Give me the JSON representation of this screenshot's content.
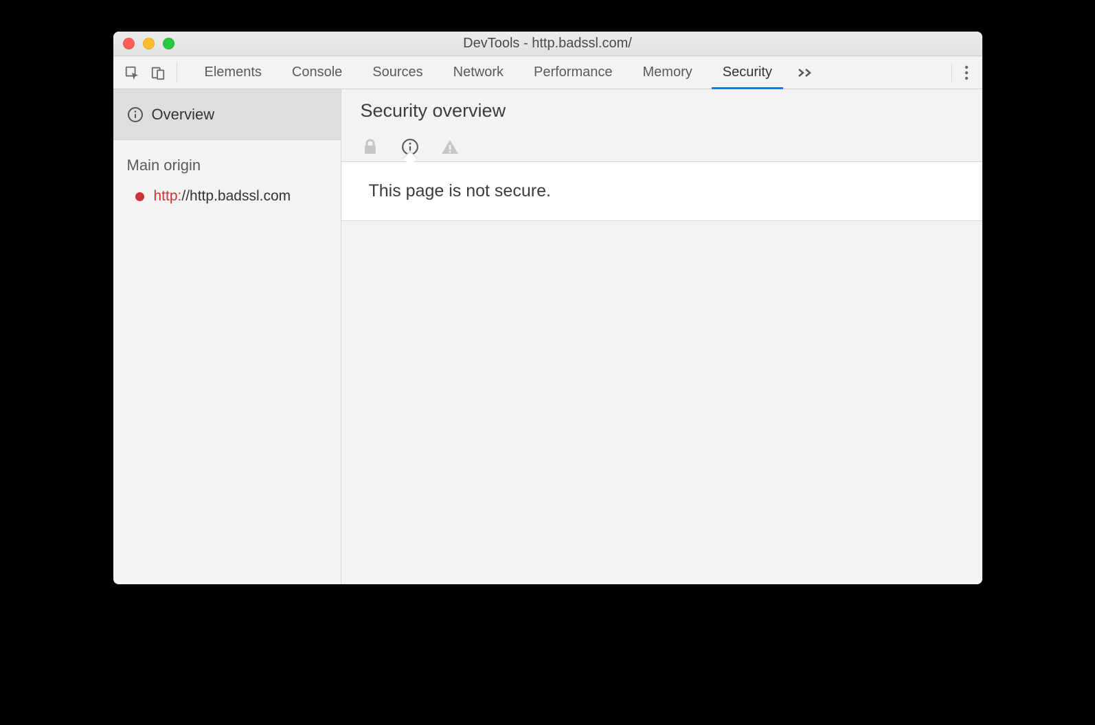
{
  "window": {
    "title": "DevTools - http.badssl.com/"
  },
  "tabs": {
    "items": [
      "Elements",
      "Console",
      "Sources",
      "Network",
      "Performance",
      "Memory",
      "Security"
    ],
    "active_index": 6
  },
  "sidebar": {
    "overview_label": "Overview",
    "section_label": "Main origin",
    "origin": {
      "scheme": "http:",
      "rest": "//http.badssl.com",
      "status_color": "#cc3232"
    }
  },
  "main": {
    "title": "Security overview",
    "notice": "This page is not secure."
  }
}
